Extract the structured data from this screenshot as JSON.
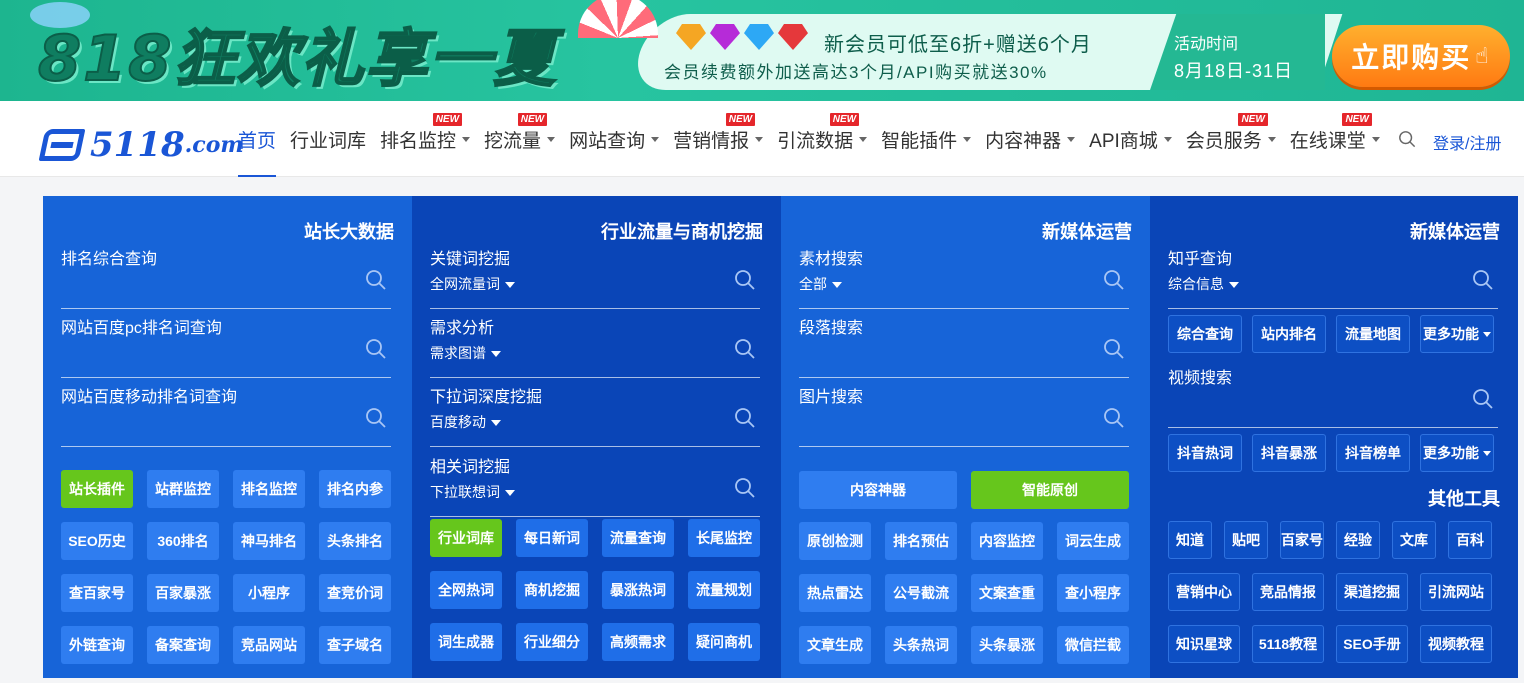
{
  "banner": {
    "title": "818狂欢礼享一夏",
    "promo_line1": "新会员可低至6折+赠送6个月",
    "promo_line2": "会员续费额外加送高达3个月/API购买就送30%",
    "activity_label": "活动时间",
    "activity_date": "8月18日-31日",
    "buy_label": "立即购买",
    "colors": {
      "bg": "#1db58f",
      "button": "#ff8a1c"
    }
  },
  "nav": {
    "logo_main": "5118",
    "logo_suffix": ".com",
    "items": [
      {
        "label": "首页",
        "active": true,
        "caret": false,
        "new": false
      },
      {
        "label": "行业词库",
        "active": false,
        "caret": false,
        "new": false
      },
      {
        "label": "排名监控",
        "active": false,
        "caret": true,
        "new": true
      },
      {
        "label": "挖流量",
        "active": false,
        "caret": true,
        "new": true
      },
      {
        "label": "网站查询",
        "active": false,
        "caret": true,
        "new": false
      },
      {
        "label": "营销情报",
        "active": false,
        "caret": true,
        "new": true
      },
      {
        "label": "引流数据",
        "active": false,
        "caret": true,
        "new": true
      },
      {
        "label": "智能插件",
        "active": false,
        "caret": true,
        "new": false
      },
      {
        "label": "内容神器",
        "active": false,
        "caret": true,
        "new": false
      },
      {
        "label": "API商城",
        "active": false,
        "caret": true,
        "new": false
      },
      {
        "label": "会员服务",
        "active": false,
        "caret": true,
        "new": true
      },
      {
        "label": "在线课堂",
        "active": false,
        "caret": true,
        "new": true
      }
    ],
    "new_badge": "NEW",
    "login": "登录/注册",
    "accent": "#1a56d6"
  },
  "panels": {
    "p1": {
      "title": "站长大数据",
      "fields": [
        {
          "label": "排名综合查询",
          "sub": ""
        },
        {
          "label": "网站百度pc排名词查询",
          "sub": ""
        },
        {
          "label": "网站百度移动排名词查询",
          "sub": ""
        }
      ],
      "buttons": [
        "站长插件",
        "站群监控",
        "排名监控",
        "排名内参",
        "SEO历史",
        "360排名",
        "神马排名",
        "头条排名",
        "查百家号",
        "百家暴涨",
        "小程序",
        "查竞价词",
        "外链查询",
        "备案查询",
        "竞品网站",
        "查子域名"
      ]
    },
    "p2": {
      "title": "行业流量与商机挖掘",
      "fields": [
        {
          "label": "关键词挖掘",
          "sub": "全网流量词"
        },
        {
          "label": "需求分析",
          "sub": "需求图谱"
        },
        {
          "label": "下拉词深度挖掘",
          "sub": "百度移动"
        },
        {
          "label": "相关词挖掘",
          "sub": "下拉联想词"
        }
      ],
      "buttons": [
        "行业词库",
        "每日新词",
        "流量查询",
        "长尾监控",
        "全网热词",
        "商机挖掘",
        "暴涨热词",
        "流量规划",
        "词生成器",
        "行业细分",
        "高频需求",
        "疑问商机"
      ]
    },
    "p3": {
      "title": "新媒体运营",
      "fields": [
        {
          "label": "素材搜索",
          "sub": "全部"
        },
        {
          "label": "段落搜索",
          "sub": ""
        },
        {
          "label": "图片搜索",
          "sub": ""
        }
      ],
      "wide_buttons": [
        "内容神器",
        "智能原创"
      ],
      "buttons": [
        "原创检测",
        "排名预估",
        "内容监控",
        "词云生成",
        "热点雷达",
        "公号截流",
        "文案查重",
        "查小程序",
        "文章生成",
        "头条热词",
        "头条暴涨",
        "微信拦截"
      ]
    },
    "p4": {
      "title": "新媒体运营",
      "zhihu": {
        "label": "知乎查询",
        "sub": "综合信息"
      },
      "zhihu_buttons": [
        "综合查询",
        "站内排名",
        "流量地图",
        "更多功能"
      ],
      "video": {
        "label": "视频搜索"
      },
      "video_buttons": [
        "抖音热词",
        "抖音暴涨",
        "抖音榜单",
        "更多功能"
      ],
      "other_title": "其他工具",
      "other_row1": [
        "知道",
        "贴吧",
        "百家号",
        "经验",
        "文库",
        "百科"
      ],
      "other_row2": [
        "营销中心",
        "竞品情报",
        "渠道挖掘",
        "引流网站"
      ],
      "other_row3": [
        "知识星球",
        "5118教程",
        "SEO手册",
        "视频教程"
      ]
    },
    "colors": {
      "light_blue": "#1764d8",
      "dark_blue": "#0a45b7",
      "green": "#66c61c"
    }
  }
}
